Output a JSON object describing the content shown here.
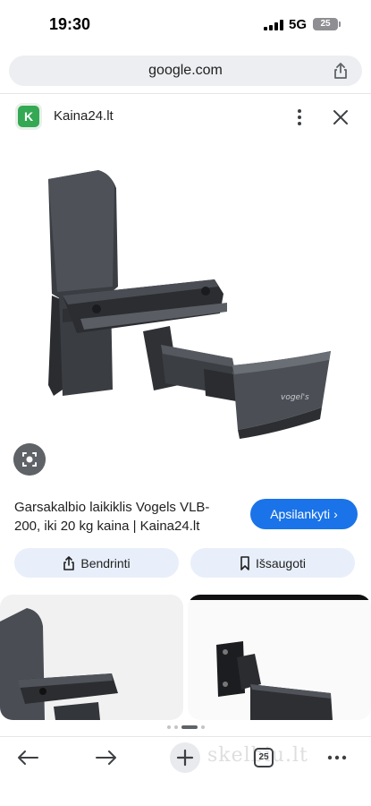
{
  "status_bar": {
    "time": "19:30",
    "network": "5G",
    "battery": "25"
  },
  "browser": {
    "url": "google.com",
    "tab_count": "25"
  },
  "source": {
    "logo_letter": "K",
    "name": "Kaina24.lt"
  },
  "result": {
    "title": "Garsakalbio laikiklis Vogels VLB-200, iki 20 kg kaina | Kaina24.lt",
    "visit_label": "Apsilankyti",
    "share_label": "Bendrinti",
    "save_label": "Išsaugoti",
    "brand_mark": "vogel's"
  },
  "watermark": "skelbiu.lt",
  "icons": {
    "share": "share-icon",
    "more": "more-vertical-icon",
    "close": "close-icon",
    "lens": "google-lens-icon",
    "bookmark": "bookmark-icon",
    "back": "back-arrow-icon",
    "forward": "forward-arrow-icon",
    "new_tab": "plus-icon",
    "tabs": "tabs-icon",
    "menu": "more-horizontal-icon"
  },
  "colors": {
    "accent": "#1a73e8",
    "source_logo": "#34a853",
    "chip_bg": "#e8effa"
  }
}
